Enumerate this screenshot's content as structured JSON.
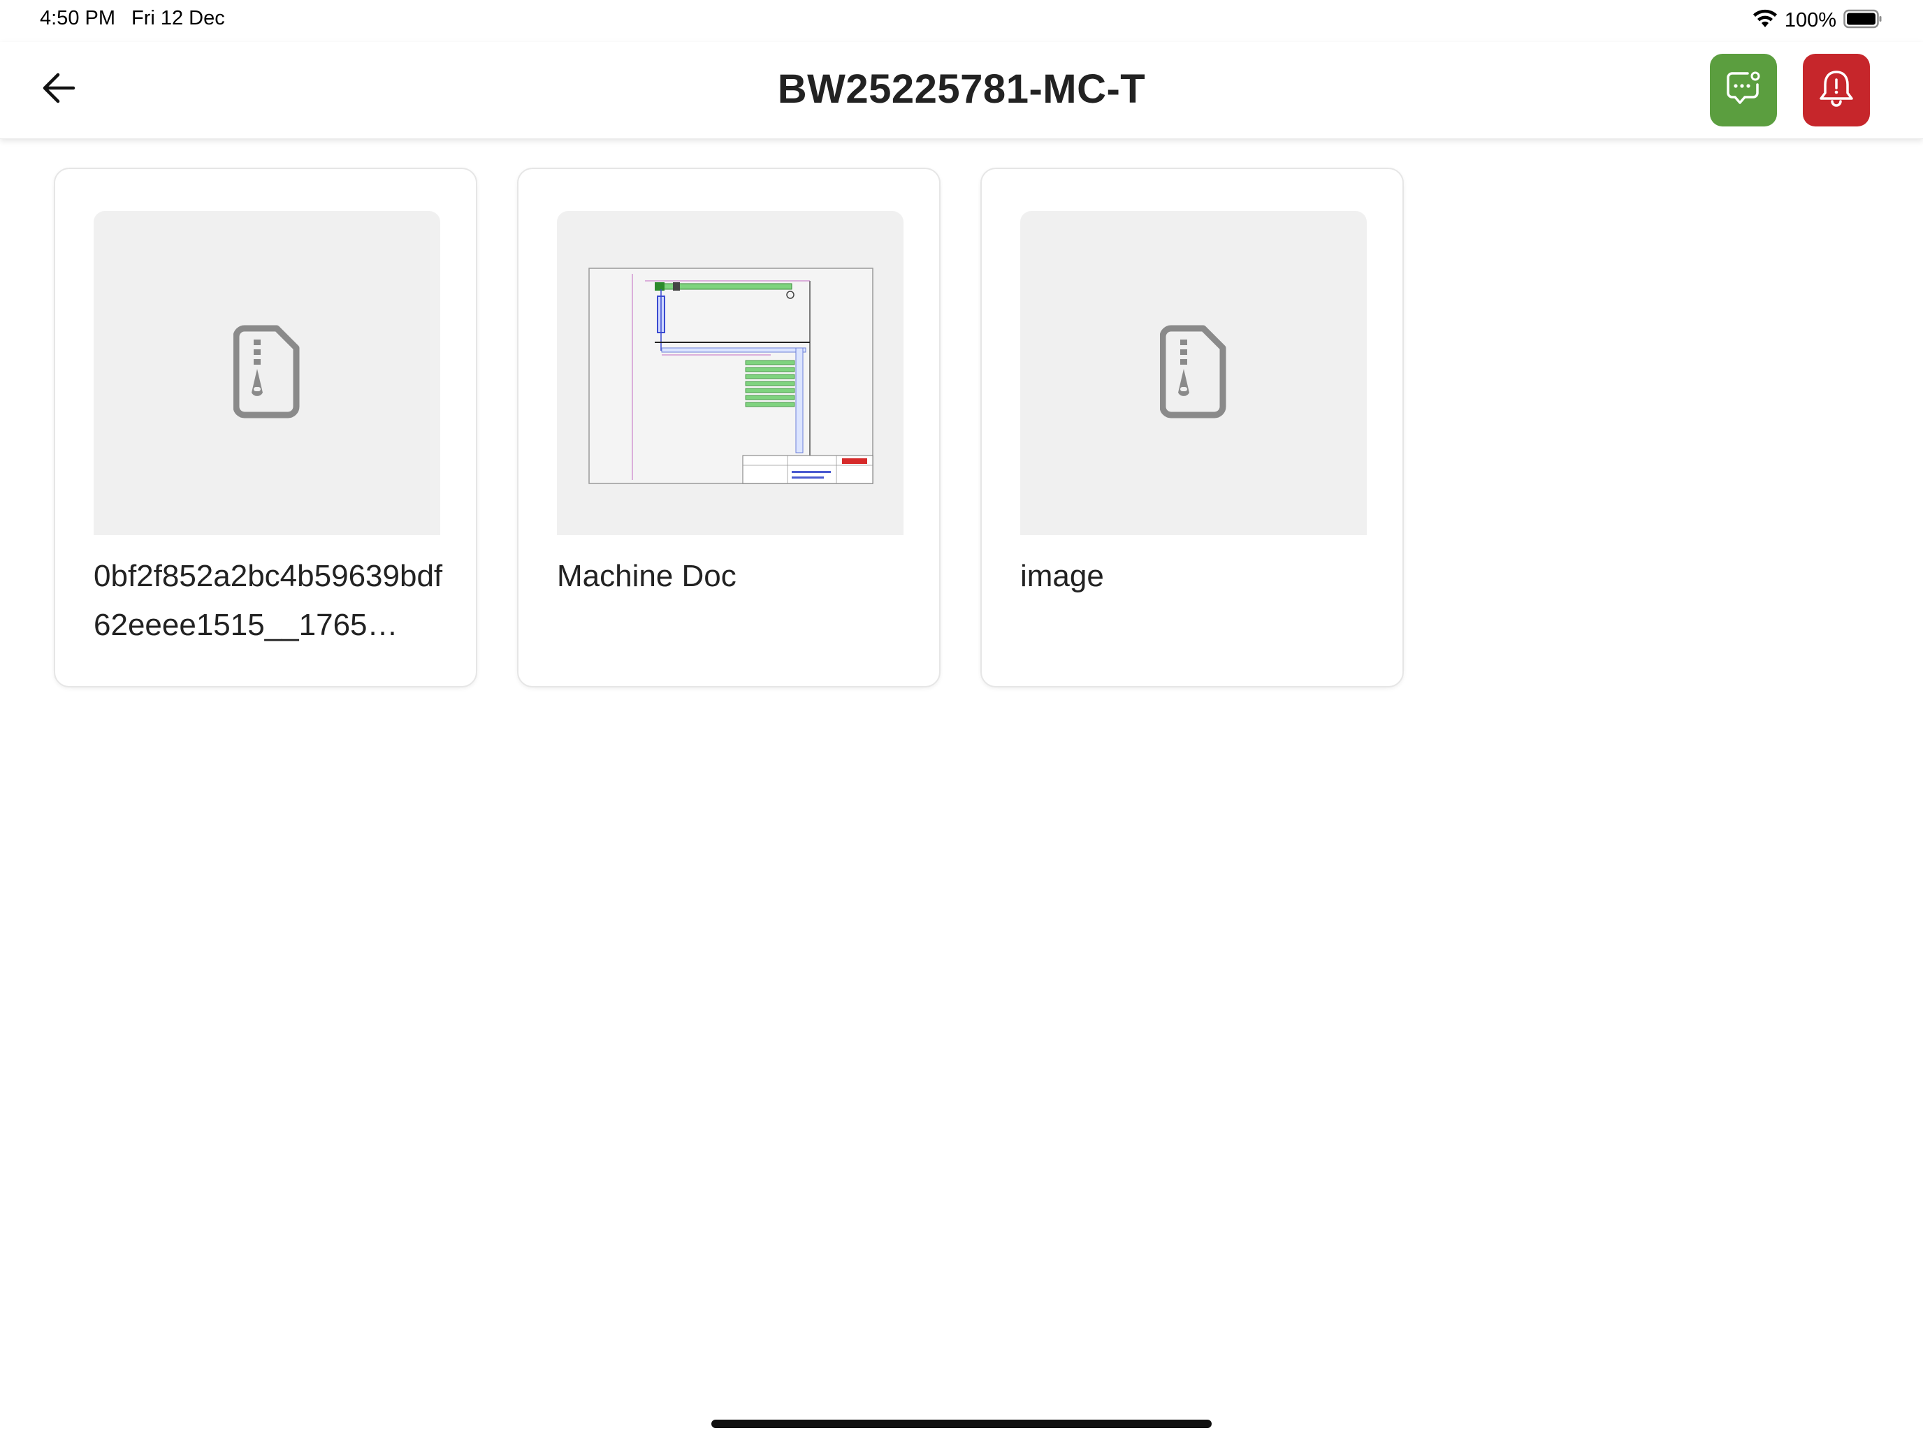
{
  "status_bar": {
    "time": "4:50 PM",
    "date": "Fri 12 Dec",
    "battery": "100%"
  },
  "header": {
    "title": "BW25225781-MC-T",
    "back_icon": "arrow-left-icon",
    "chat_icon": "chat-bubble-dots-icon",
    "alert_icon": "bell-alert-icon"
  },
  "colors": {
    "chat_button": "#5b9e3f",
    "alert_button": "#c6262b",
    "card_border": "#e6e6e6",
    "thumb_background": "#f0f0f0",
    "file_icon": "#8a8a8a"
  },
  "documents": [
    {
      "label": "0bf2f852a2bc4b59639bdf62eeee1515__1765…",
      "thumbnail": "zip-file-icon"
    },
    {
      "label": "Machine Doc",
      "thumbnail": "technical-drawing-preview"
    },
    {
      "label": "image",
      "thumbnail": "zip-file-icon"
    }
  ]
}
